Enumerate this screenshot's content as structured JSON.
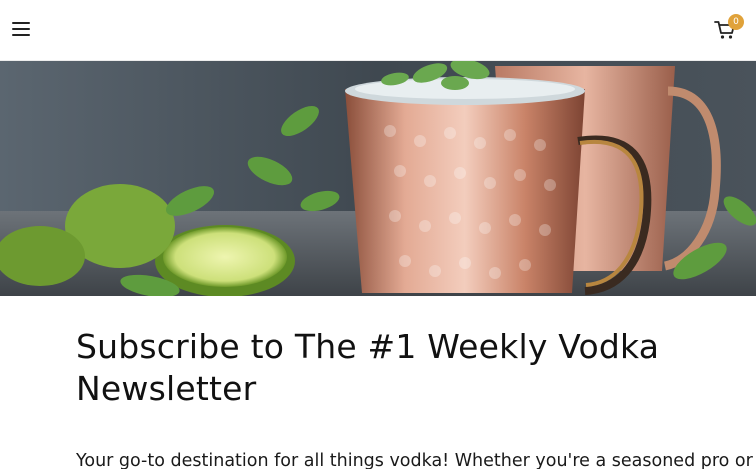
{
  "header": {
    "menu_icon": "hamburger-menu-icon",
    "cart_icon": "shopping-cart-icon",
    "cart_count": "0",
    "badge_color": "#e0a23a"
  },
  "hero": {
    "image": "copper mule mugs with ice, mint and lime wedges on a dark stone surface"
  },
  "main": {
    "title": "Subscribe to The #1 Weekly Vodka Newsletter",
    "intro": "Your go-to destination for all things vodka! Whether you're a seasoned pro or a"
  }
}
